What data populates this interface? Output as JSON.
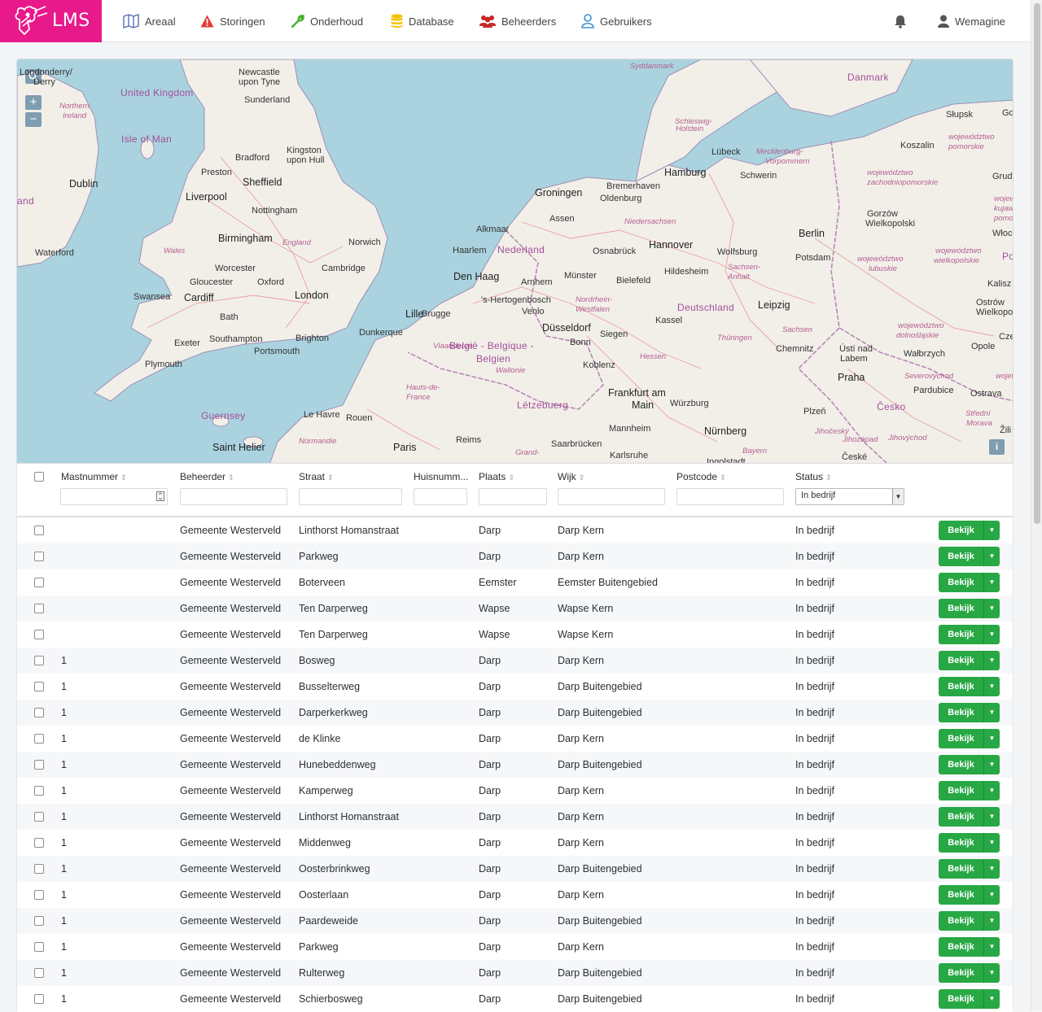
{
  "brand": {
    "name": "LMS",
    "color": "#e8198b"
  },
  "nav": {
    "items": [
      {
        "label": "Areaal",
        "icon": "map-icon"
      },
      {
        "label": "Storingen",
        "icon": "warning-icon"
      },
      {
        "label": "Onderhoud",
        "icon": "wrench-icon"
      },
      {
        "label": "Database",
        "icon": "database-icon"
      },
      {
        "label": "Beheerders",
        "icon": "users-icon"
      },
      {
        "label": "Gebruikers",
        "icon": "user-outline-icon"
      }
    ],
    "notifications_icon": "bell-icon",
    "user": {
      "label": "Wemagine",
      "icon": "user-icon"
    }
  },
  "map": {
    "controls": {
      "search": "search-icon",
      "zoom_in": "+",
      "zoom_out": "−",
      "info": "i"
    },
    "labels": [
      {
        "text": "Londonderry/",
        "cls": ""
      },
      {
        "text": "Derry",
        "cls": ""
      },
      {
        "text": "United Kingdom",
        "cls": "country"
      },
      {
        "text": "Northern",
        "cls": "region"
      },
      {
        "text": "Ireland",
        "cls": "region"
      },
      {
        "text": "Isle of Man",
        "cls": "country"
      },
      {
        "text": "Dublin",
        "cls": "big"
      },
      {
        "text": "and",
        "cls": "country"
      },
      {
        "text": "Waterford",
        "cls": ""
      },
      {
        "text": "Newcastle",
        "cls": ""
      },
      {
        "text": "upon Tyne",
        "cls": ""
      },
      {
        "text": "Sunderland",
        "cls": ""
      },
      {
        "text": "Bradford",
        "cls": ""
      },
      {
        "text": "Preston",
        "cls": ""
      },
      {
        "text": "Kingston",
        "cls": ""
      },
      {
        "text": "upon Hull",
        "cls": ""
      },
      {
        "text": "Sheffield",
        "cls": "big"
      },
      {
        "text": "Liverpool",
        "cls": "big"
      },
      {
        "text": "Nottingham",
        "cls": ""
      },
      {
        "text": "Birmingham",
        "cls": "big"
      },
      {
        "text": "England",
        "cls": "region"
      },
      {
        "text": "Norwich",
        "cls": ""
      },
      {
        "text": "Wales",
        "cls": "region"
      },
      {
        "text": "Worcester",
        "cls": ""
      },
      {
        "text": "Cambridge",
        "cls": ""
      },
      {
        "text": "Gloucester",
        "cls": ""
      },
      {
        "text": "Oxford",
        "cls": ""
      },
      {
        "text": "Swansea",
        "cls": ""
      },
      {
        "text": "Cardiff",
        "cls": "big"
      },
      {
        "text": "London",
        "cls": "big"
      },
      {
        "text": "Bath",
        "cls": ""
      },
      {
        "text": "Exeter",
        "cls": ""
      },
      {
        "text": "Southampton",
        "cls": ""
      },
      {
        "text": "Brighton",
        "cls": ""
      },
      {
        "text": "Portsmouth",
        "cls": ""
      },
      {
        "text": "Plymouth",
        "cls": ""
      },
      {
        "text": "Dunkerque",
        "cls": ""
      },
      {
        "text": "Guernsey",
        "cls": "country"
      },
      {
        "text": "Saint Helier",
        "cls": "big"
      },
      {
        "text": "Le Havre",
        "cls": ""
      },
      {
        "text": "Rouen",
        "cls": ""
      },
      {
        "text": "Normandie",
        "cls": "region"
      },
      {
        "text": "Paris",
        "cls": "big"
      },
      {
        "text": "Reims",
        "cls": ""
      },
      {
        "text": "Hauts-de-",
        "cls": "region"
      },
      {
        "text": "France",
        "cls": "region"
      },
      {
        "text": "Lille",
        "cls": "big"
      },
      {
        "text": "Brugge",
        "cls": ""
      },
      {
        "text": "Vlaanderen",
        "cls": "region"
      },
      {
        "text": "België - Belgique -",
        "cls": "country"
      },
      {
        "text": "Belgien",
        "cls": "country"
      },
      {
        "text": "Wallonie",
        "cls": "region"
      },
      {
        "text": "Lëtzebuerg",
        "cls": "country"
      },
      {
        "text": "Grand-",
        "cls": "region"
      },
      {
        "text": "Den Haag",
        "cls": "big"
      },
      {
        "text": "Haarlem",
        "cls": ""
      },
      {
        "text": "Nederland",
        "cls": "country"
      },
      {
        "text": "Alkmaar",
        "cls": ""
      },
      {
        "text": "Groningen",
        "cls": "big"
      },
      {
        "text": "Assen",
        "cls": ""
      },
      {
        "text": "Arnhem",
        "cls": ""
      },
      {
        "text": "'s-Hertogenbosch",
        "cls": ""
      },
      {
        "text": "Venlo",
        "cls": ""
      },
      {
        "text": "Münster",
        "cls": ""
      },
      {
        "text": "Nordrhein-",
        "cls": "region"
      },
      {
        "text": "Westfalen",
        "cls": "region"
      },
      {
        "text": "Düsseldorf",
        "cls": "big"
      },
      {
        "text": "Bonn",
        "cls": ""
      },
      {
        "text": "Siegen",
        "cls": ""
      },
      {
        "text": "Koblenz",
        "cls": ""
      },
      {
        "text": "Hessen",
        "cls": "region"
      },
      {
        "text": "Frankfurt am",
        "cls": "big"
      },
      {
        "text": "Main",
        "cls": "big"
      },
      {
        "text": "Mannheim",
        "cls": ""
      },
      {
        "text": "Saarbrücken",
        "cls": ""
      },
      {
        "text": "Karlsruhe",
        "cls": ""
      },
      {
        "text": "Würzburg",
        "cls": ""
      },
      {
        "text": "Nürnberg",
        "cls": "big"
      },
      {
        "text": "Bayern",
        "cls": "region"
      },
      {
        "text": "Ingolstadt",
        "cls": ""
      },
      {
        "text": "Oldenburg",
        "cls": ""
      },
      {
        "text": "Bremerhaven",
        "cls": ""
      },
      {
        "text": "Niedersachsen",
        "cls": "region"
      },
      {
        "text": "Osnabrück",
        "cls": ""
      },
      {
        "text": "Bielefeld",
        "cls": ""
      },
      {
        "text": "Hildesheim",
        "cls": ""
      },
      {
        "text": "Hannover",
        "cls": "big"
      },
      {
        "text": "Wolfsburg",
        "cls": ""
      },
      {
        "text": "Sachsen-",
        "cls": "region"
      },
      {
        "text": "Anhalt",
        "cls": "region"
      },
      {
        "text": "Deutschland",
        "cls": "country"
      },
      {
        "text": "Kassel",
        "cls": ""
      },
      {
        "text": "Thüringen",
        "cls": "region"
      },
      {
        "text": "Leipzig",
        "cls": "big"
      },
      {
        "text": "Sachsen",
        "cls": "region"
      },
      {
        "text": "Chemnitz",
        "cls": ""
      },
      {
        "text": "Hamburg",
        "cls": "big"
      },
      {
        "text": "Lübeck",
        "cls": ""
      },
      {
        "text": "Schwerin",
        "cls": ""
      },
      {
        "text": "Schleswig-",
        "cls": "region"
      },
      {
        "text": "Holstein",
        "cls": "region"
      },
      {
        "text": "Mecklenburg-",
        "cls": "region"
      },
      {
        "text": "Vorpommern",
        "cls": "region"
      },
      {
        "text": "Syddanmark",
        "cls": "region"
      },
      {
        "text": "Danmark",
        "cls": "country"
      },
      {
        "text": "Berlin",
        "cls": "big"
      },
      {
        "text": "Potsdam",
        "cls": ""
      },
      {
        "text": "Ústí nad",
        "cls": ""
      },
      {
        "text": "Labem",
        "cls": ""
      },
      {
        "text": "Praha",
        "cls": "big"
      },
      {
        "text": "Česko",
        "cls": "country"
      },
      {
        "text": "Plzeň",
        "cls": ""
      },
      {
        "text": "Jihočeský",
        "cls": "region"
      },
      {
        "text": "Jihozápad",
        "cls": "region"
      },
      {
        "text": "Severovýchod",
        "cls": "region"
      },
      {
        "text": "Pardubice",
        "cls": ""
      },
      {
        "text": "České",
        "cls": ""
      },
      {
        "text": "Słupsk",
        "cls": ""
      },
      {
        "text": "Gdyni",
        "cls": ""
      },
      {
        "text": "województwo",
        "cls": "region"
      },
      {
        "text": "pomorskie",
        "cls": "region"
      },
      {
        "text": "Koszalin",
        "cls": ""
      },
      {
        "text": "województwo",
        "cls": "region"
      },
      {
        "text": "zachodniopomorskie",
        "cls": "region"
      },
      {
        "text": "Grudz",
        "cls": ""
      },
      {
        "text": "wojewód",
        "cls": "region"
      },
      {
        "text": "kujawsk",
        "cls": "region"
      },
      {
        "text": "pomorsk",
        "cls": "region"
      },
      {
        "text": "Gorzów",
        "cls": ""
      },
      {
        "text": "Wielkopolski",
        "cls": ""
      },
      {
        "text": "Włocław",
        "cls": ""
      },
      {
        "text": "województwo",
        "cls": "region"
      },
      {
        "text": "lubuskie",
        "cls": "region"
      },
      {
        "text": "województwo",
        "cls": "region"
      },
      {
        "text": "wielkopolskie",
        "cls": "region"
      },
      {
        "text": "Po",
        "cls": "country"
      },
      {
        "text": "Kalisz",
        "cls": ""
      },
      {
        "text": "Ostrów",
        "cls": ""
      },
      {
        "text": "Wielkopolski",
        "cls": ""
      },
      {
        "text": "województwo",
        "cls": "region"
      },
      {
        "text": "dolnośląskie",
        "cls": "region"
      },
      {
        "text": "Wałbrzych",
        "cls": ""
      },
      {
        "text": "Opole",
        "cls": ""
      },
      {
        "text": "Cze",
        "cls": ""
      },
      {
        "text": "wojew",
        "cls": "region"
      },
      {
        "text": "Ostrava",
        "cls": ""
      },
      {
        "text": "Střední",
        "cls": "region"
      },
      {
        "text": "Morava",
        "cls": "region"
      },
      {
        "text": "Žili",
        "cls": ""
      },
      {
        "text": "Jihovýchod",
        "cls": "region"
      }
    ]
  },
  "table": {
    "columns": [
      {
        "label": "Mastnummer",
        "sortable": true
      },
      {
        "label": "Beheerder",
        "sortable": true
      },
      {
        "label": "Straat",
        "sortable": true
      },
      {
        "label": "Huisnumm...",
        "sortable": false
      },
      {
        "label": "Plaats",
        "sortable": true
      },
      {
        "label": "Wijk",
        "sortable": true
      },
      {
        "label": "Postcode",
        "sortable": true
      },
      {
        "label": "Status",
        "sortable": true
      }
    ],
    "status_filter_value": "In bedrijf",
    "view_button_label": "Bekijk",
    "rows": [
      {
        "mast": "",
        "beheerder": "Gemeente Westerveld",
        "straat": "Linthorst Homanstraat",
        "plaats": "Darp",
        "wijk": "Darp Kern",
        "status": "In bedrijf"
      },
      {
        "mast": "",
        "beheerder": "Gemeente Westerveld",
        "straat": "Parkweg",
        "plaats": "Darp",
        "wijk": "Darp Kern",
        "status": "In bedrijf"
      },
      {
        "mast": "",
        "beheerder": "Gemeente Westerveld",
        "straat": "Boterveen",
        "plaats": "Eemster",
        "wijk": "Eemster Buitengebied",
        "status": "In bedrijf"
      },
      {
        "mast": "",
        "beheerder": "Gemeente Westerveld",
        "straat": "Ten Darperweg",
        "plaats": "Wapse",
        "wijk": "Wapse Kern",
        "status": "In bedrijf"
      },
      {
        "mast": "",
        "beheerder": "Gemeente Westerveld",
        "straat": "Ten Darperweg",
        "plaats": "Wapse",
        "wijk": "Wapse Kern",
        "status": "In bedrijf"
      },
      {
        "mast": "1",
        "beheerder": "Gemeente Westerveld",
        "straat": "Bosweg",
        "plaats": "Darp",
        "wijk": "Darp Kern",
        "status": "In bedrijf"
      },
      {
        "mast": "1",
        "beheerder": "Gemeente Westerveld",
        "straat": "Busselterweg",
        "plaats": "Darp",
        "wijk": "Darp Buitengebied",
        "status": "In bedrijf"
      },
      {
        "mast": "1",
        "beheerder": "Gemeente Westerveld",
        "straat": "Darperkerkweg",
        "plaats": "Darp",
        "wijk": "Darp Buitengebied",
        "status": "In bedrijf"
      },
      {
        "mast": "1",
        "beheerder": "Gemeente Westerveld",
        "straat": "de Klinke",
        "plaats": "Darp",
        "wijk": "Darp Kern",
        "status": "In bedrijf"
      },
      {
        "mast": "1",
        "beheerder": "Gemeente Westerveld",
        "straat": "Hunebeddenweg",
        "plaats": "Darp",
        "wijk": "Darp Buitengebied",
        "status": "In bedrijf"
      },
      {
        "mast": "1",
        "beheerder": "Gemeente Westerveld",
        "straat": "Kamperweg",
        "plaats": "Darp",
        "wijk": "Darp Kern",
        "status": "In bedrijf"
      },
      {
        "mast": "1",
        "beheerder": "Gemeente Westerveld",
        "straat": "Linthorst Homanstraat",
        "plaats": "Darp",
        "wijk": "Darp Kern",
        "status": "In bedrijf"
      },
      {
        "mast": "1",
        "beheerder": "Gemeente Westerveld",
        "straat": "Middenweg",
        "plaats": "Darp",
        "wijk": "Darp Kern",
        "status": "In bedrijf"
      },
      {
        "mast": "1",
        "beheerder": "Gemeente Westerveld",
        "straat": "Oosterbrinkweg",
        "plaats": "Darp",
        "wijk": "Darp Buitengebied",
        "status": "In bedrijf"
      },
      {
        "mast": "1",
        "beheerder": "Gemeente Westerveld",
        "straat": "Oosterlaan",
        "plaats": "Darp",
        "wijk": "Darp Kern",
        "status": "In bedrijf"
      },
      {
        "mast": "1",
        "beheerder": "Gemeente Westerveld",
        "straat": "Paardeweide",
        "plaats": "Darp",
        "wijk": "Darp Buitengebied",
        "status": "In bedrijf"
      },
      {
        "mast": "1",
        "beheerder": "Gemeente Westerveld",
        "straat": "Parkweg",
        "plaats": "Darp",
        "wijk": "Darp Kern",
        "status": "In bedrijf"
      },
      {
        "mast": "1",
        "beheerder": "Gemeente Westerveld",
        "straat": "Rulterweg",
        "plaats": "Darp",
        "wijk": "Darp Buitengebied",
        "status": "In bedrijf"
      },
      {
        "mast": "1",
        "beheerder": "Gemeente Westerveld",
        "straat": "Schierbosweg",
        "plaats": "Darp",
        "wijk": "Darp Buitengebied",
        "status": "In bedrijf"
      }
    ]
  },
  "colors": {
    "accent": "#e8198b",
    "success": "#27a844",
    "warning": "#e53935",
    "wrench": "#43b02a",
    "database": "#f2c200",
    "users": "#c62828",
    "user_outline": "#3b8fd6",
    "map_icon": "#5b6fb5"
  }
}
